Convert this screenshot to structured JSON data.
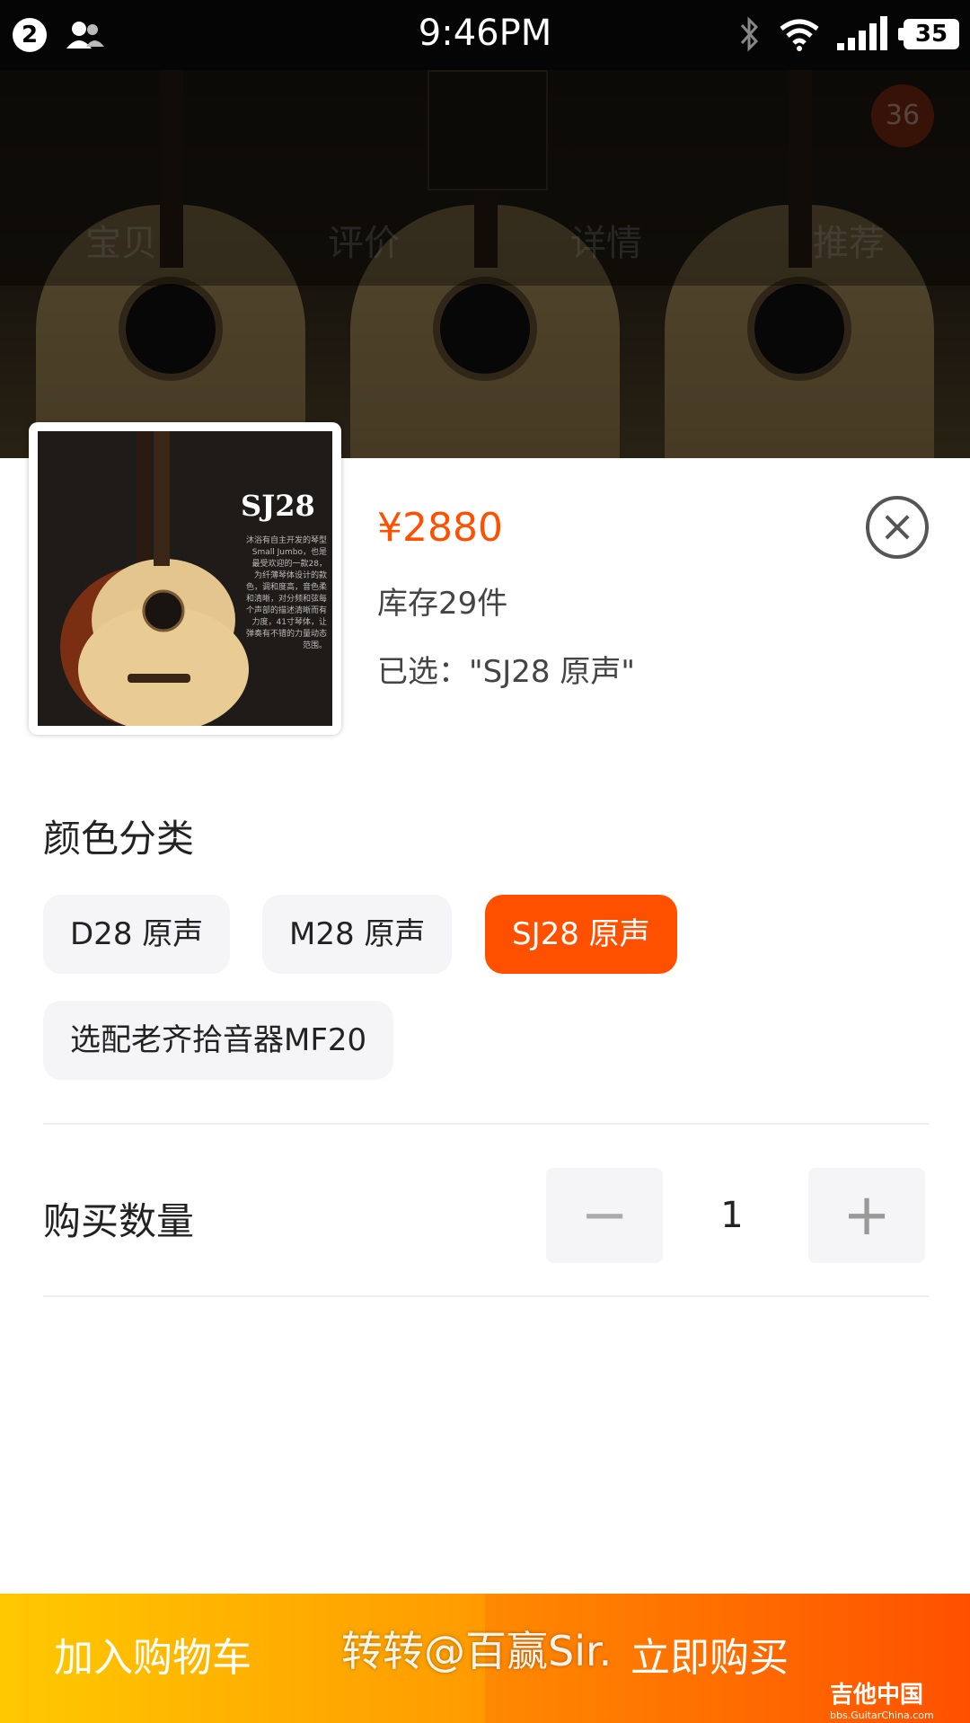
{
  "status_bar": {
    "notifications": "2",
    "time": "9:46PM",
    "battery": "35"
  },
  "background_page": {
    "badge": "36",
    "tabs": [
      "宝贝",
      "评价",
      "详情",
      "推荐"
    ]
  },
  "product": {
    "image_title": "SJ28",
    "image_text": "沐浴有自主开发的琴型 Small Jumbo，也是最受欢迎的一款28，为纤薄琴体设计的款色，调和度高，音色柔和清晰，对分频和弦每个声部的描述清晰而有力度，41寸琴体，让弹奏有不错的力量动态范围。",
    "price": "¥2880",
    "stock": "库存29件",
    "selected": "已选：\"SJ28 原声\""
  },
  "color_section": {
    "title": "颜色分类",
    "options": [
      {
        "label": "D28 原声",
        "selected": false
      },
      {
        "label": "M28 原声",
        "selected": false
      },
      {
        "label": "SJ28 原声",
        "selected": true
      },
      {
        "label": "选配老齐拾音器MF20",
        "selected": false
      }
    ]
  },
  "quantity": {
    "label": "购买数量",
    "value": "1",
    "minus": "−",
    "plus": "+"
  },
  "actions": {
    "add_to_cart": "加入购物车",
    "buy_now": "立即购买"
  },
  "watermark": {
    "text": "转转@百赢Sir.",
    "logo_main": "吉他中国",
    "logo_sub": "bbs.GuitarChina.com"
  },
  "colors": {
    "accent": "#ff5000",
    "cart_start": "#ffc900",
    "cart_end": "#ff9a00",
    "buy_end": "#ff5000"
  },
  "icons": [
    "contacts-icon",
    "bluetooth-icon",
    "wifi-icon",
    "signal-icon",
    "battery-icon",
    "close-icon",
    "location-icon"
  ]
}
